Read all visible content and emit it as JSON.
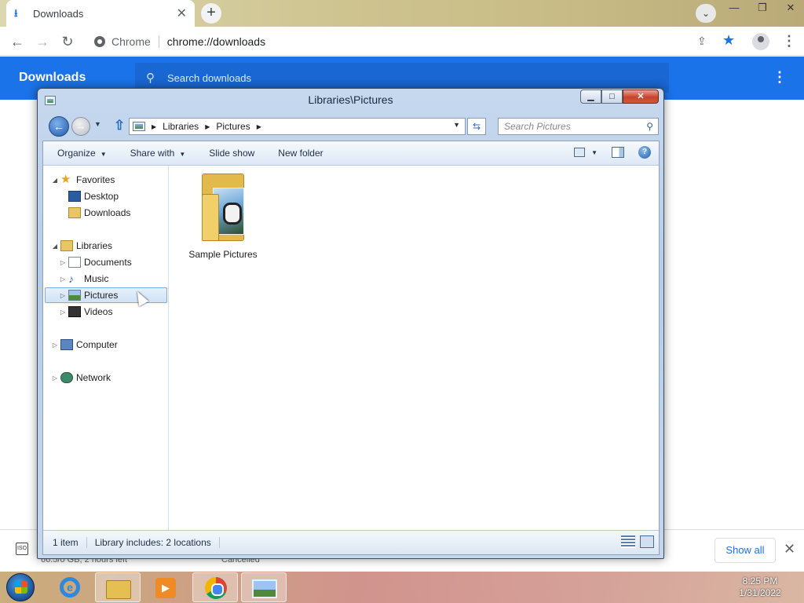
{
  "chrome": {
    "tab_title": "Downloads",
    "tab_close": "✕",
    "new_tab": "+",
    "omnibox_site": "Chrome",
    "omnibox_url": "chrome://downloads",
    "page_title": "Downloads",
    "search_placeholder": "Search downloads",
    "shelf": {
      "item1_status": "66.5/0 GB, 2 hours left",
      "item2_status": "Cancelled",
      "show_all": "Show all"
    }
  },
  "explorer": {
    "title": "Libraries\\Pictures",
    "breadcrumb": [
      "Libraries",
      "Pictures"
    ],
    "search_placeholder": "Search Pictures",
    "commands": [
      "Organize",
      "Share with",
      "Slide show",
      "New folder"
    ],
    "nav": {
      "favorites": "Favorites",
      "desktop": "Desktop",
      "downloads": "Downloads",
      "libraries": "Libraries",
      "documents": "Documents",
      "music": "Music",
      "pictures": "Pictures",
      "videos": "Videos",
      "computer": "Computer",
      "network": "Network"
    },
    "items": [
      {
        "label": "Sample Pictures",
        "icon": "folder-with-pictures-icon"
      }
    ],
    "status": {
      "count": "1 item",
      "library": "Library includes: 2 locations"
    }
  },
  "taskbar": {
    "time": "8:25 PM",
    "date": "1/31/2022"
  }
}
